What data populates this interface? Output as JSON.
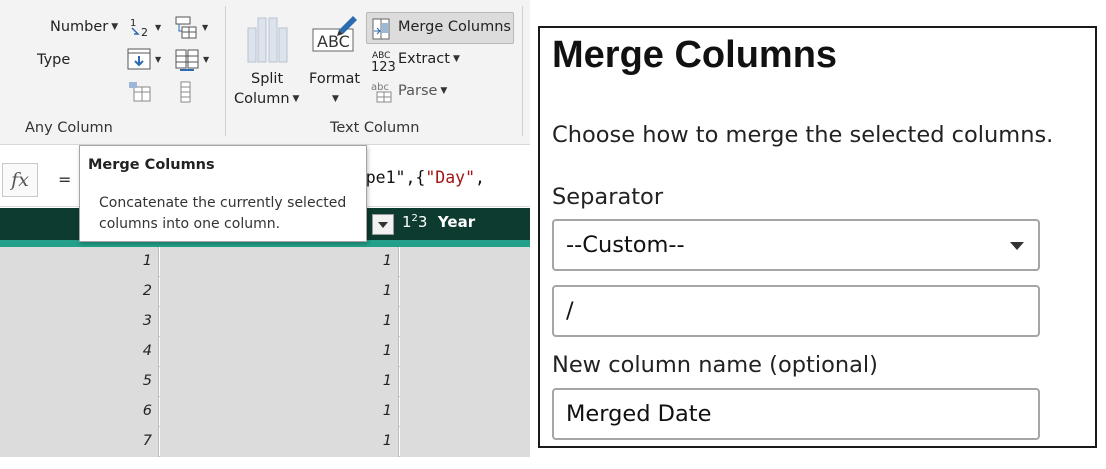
{
  "ribbon": {
    "number_label": "Number",
    "type_label": "Type",
    "split_column_line1": "Split",
    "split_column_line2": "Column",
    "format_label": "Format",
    "merge_columns_label": "Merge Columns",
    "extract_label": "Extract",
    "parse_label": "Parse",
    "group_any_column": "Any Column",
    "group_text_column": "Text Column"
  },
  "formula_bar": {
    "fx_label": "fx",
    "equals": "=",
    "text_prefix": "d Type1\",{",
    "text_string": "\"Day\"",
    "text_suffix": ","
  },
  "tooltip": {
    "title": "Merge Columns",
    "description": "Concatenate the currently selected columns into one column."
  },
  "grid": {
    "year_header": "Year",
    "rows": [
      {
        "c1": "1",
        "c2": "1"
      },
      {
        "c1": "2",
        "c2": "1"
      },
      {
        "c1": "3",
        "c2": "1"
      },
      {
        "c1": "4",
        "c2": "1"
      },
      {
        "c1": "5",
        "c2": "1"
      },
      {
        "c1": "6",
        "c2": "1"
      },
      {
        "c1": "7",
        "c2": "1"
      }
    ]
  },
  "dialog": {
    "title": "Merge Columns",
    "description": "Choose how to merge the selected columns.",
    "separator_label": "Separator",
    "separator_value": "--Custom--",
    "custom_value": "/",
    "new_column_label": "New column name (optional)",
    "new_column_value": "Merged Date"
  },
  "colors": {
    "grid_header": "#0d3b2f",
    "grid_accent": "#22a08a",
    "string_literal": "#a31515"
  },
  "icons": [
    "data-type-icon",
    "replace-values-icon",
    "fill-icon",
    "pivot-column-icon",
    "move-icon",
    "split-column-icon",
    "format-icon",
    "merge-columns-icon",
    "extract-icon",
    "parse-icon",
    "dropdown-arrow-icon",
    "whole-number-icon"
  ]
}
